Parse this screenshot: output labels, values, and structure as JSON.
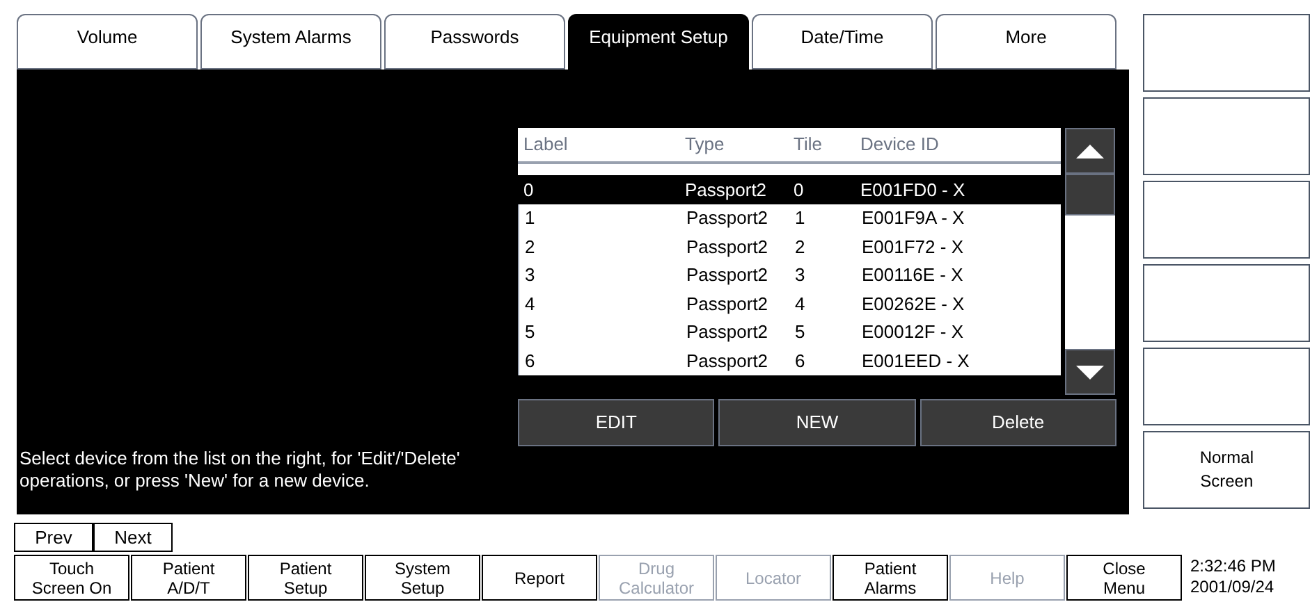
{
  "tabs": [
    {
      "label": "Volume",
      "selected": false
    },
    {
      "label": "System Alarms",
      "selected": false
    },
    {
      "label": "Passwords",
      "selected": false
    },
    {
      "label": "Equipment Setup",
      "selected": true
    },
    {
      "label": "Date/Time",
      "selected": false
    },
    {
      "label": "More",
      "selected": false
    }
  ],
  "message": "Select device from the list on the right, for 'Edit'/'Delete' operations, or press 'New' for a new device.",
  "device_table": {
    "columns": [
      "Label",
      "Type",
      "Tile",
      "Device ID"
    ],
    "rows": [
      {
        "cells": [
          "0",
          "Passport2",
          "0",
          "E001FD0 - X"
        ],
        "selected": true
      },
      {
        "cells": [
          "1",
          "Passport2",
          "1",
          "E001F9A - X"
        ],
        "selected": false
      },
      {
        "cells": [
          "2",
          "Passport2",
          "2",
          "E001F72 - X"
        ],
        "selected": false
      },
      {
        "cells": [
          "3",
          "Passport2",
          "3",
          "E00116E - X"
        ],
        "selected": false
      },
      {
        "cells": [
          "4",
          "Passport2",
          "4",
          "E00262E - X"
        ],
        "selected": false
      },
      {
        "cells": [
          "5",
          "Passport2",
          "5",
          "E00012F - X"
        ],
        "selected": false
      },
      {
        "cells": [
          "6",
          "Passport2",
          "6",
          "E001EED - X"
        ],
        "selected": false
      }
    ]
  },
  "table_buttons": [
    "EDIT",
    "NEW",
    "Delete"
  ],
  "side_buttons": [
    {
      "kind": "blank"
    },
    {
      "kind": "blank"
    },
    {
      "kind": "blank"
    },
    {
      "kind": "blank"
    },
    {
      "kind": "blank"
    },
    {
      "kind": "labeled",
      "label": "Normal Screen"
    }
  ],
  "pager": [
    "Prev",
    "Next"
  ],
  "menu_buttons": [
    {
      "label": "Touch Screen On",
      "disabled": false
    },
    {
      "label": "Patient A/D/T",
      "disabled": false
    },
    {
      "label": "Patient Setup",
      "disabled": false
    },
    {
      "label": "System Setup",
      "disabled": false
    },
    {
      "label": "Report",
      "disabled": false
    },
    {
      "label": "Drug Calculator",
      "disabled": true
    },
    {
      "label": "Locator",
      "disabled": true
    },
    {
      "label": "Patient Alarms",
      "disabled": false
    },
    {
      "label": "Help",
      "disabled": true
    },
    {
      "label": "Close Menu",
      "disabled": false
    }
  ],
  "time": "2:32:46 PM",
  "date": "2001/09/24"
}
